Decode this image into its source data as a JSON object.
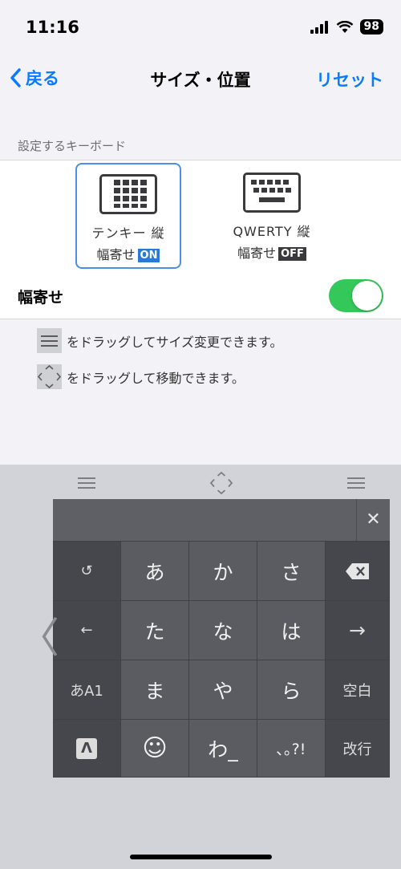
{
  "status_bar": {
    "time": "11:16",
    "battery": "98",
    "icons": [
      "signal-icon",
      "wifi-icon",
      "battery-icon"
    ]
  },
  "nav": {
    "back_label": "戻る",
    "title": "サイズ・位置",
    "reset_label": "リセット"
  },
  "section": {
    "header": "設定するキーボード"
  },
  "keyboard_options": [
    {
      "name": "テンキー 縦",
      "mode_label": "幅寄せ",
      "badge": "ON",
      "selected": true
    },
    {
      "name": "QWERTY 縦",
      "mode_label": "幅寄せ",
      "badge": "OFF",
      "selected": false
    }
  ],
  "toggle_row": {
    "label": "幅寄せ",
    "enabled": true
  },
  "hints": [
    {
      "icon": "resize-handle-icon",
      "text": "をドラッグしてサイズ変更できます。"
    },
    {
      "icon": "move-handle-icon",
      "text": "をドラッグして移動できます。"
    }
  ],
  "keyboard": {
    "close_icon": "close-icon",
    "left_column": [
      "↺",
      "←",
      "あA1",
      "Λ"
    ],
    "center_rows": [
      [
        "あ",
        "か",
        "さ"
      ],
      [
        "た",
        "な",
        "は"
      ],
      [
        "ま",
        "や",
        "ら"
      ],
      [
        "☺",
        "わ_",
        "､｡?!"
      ]
    ],
    "right_column": [
      "⌫",
      "→",
      "空白",
      "改行"
    ]
  },
  "colors": {
    "accent": "#0a7aff",
    "toggle_on": "#34c759",
    "badge_on": "#2a79d8"
  }
}
